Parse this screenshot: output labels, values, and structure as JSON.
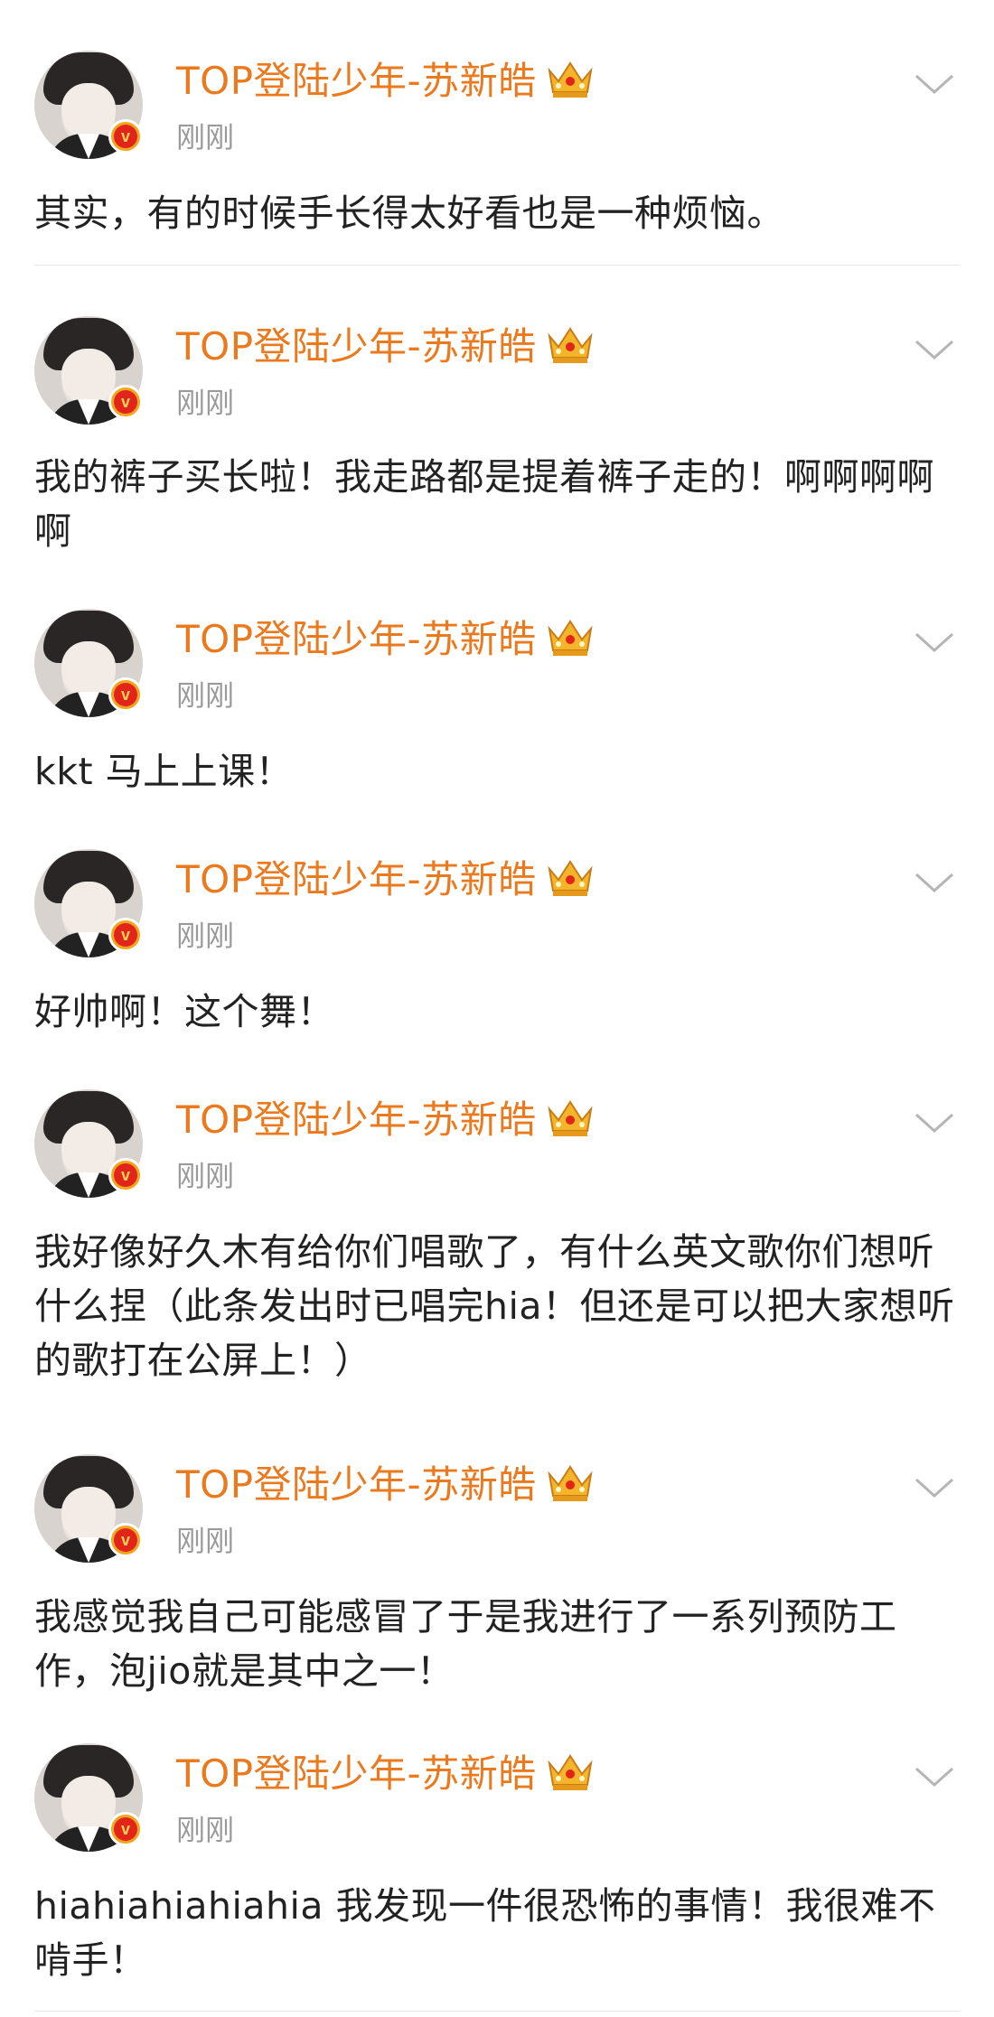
{
  "author_name": "TOP登陆少年-苏新皓",
  "timestamp": "刚刚",
  "accent_color": "#eb7a1f",
  "badge_icon": "verified-v-badge",
  "crown_icon": "crown-vip-icon",
  "posts": [
    {
      "text": "其实，有的时候手长得太好看也是一种烦恼。"
    },
    {
      "text": "我的裤子买长啦！我走路都是提着裤子走的！啊啊啊啊啊"
    },
    {
      "text": "kkt 马上上课！"
    },
    {
      "text": "好帅啊！这个舞！"
    },
    {
      "text": "我好像好久木有给你们唱歌了，有什么英文歌你们想听什么捏（此条发出时已唱完hia！但还是可以把大家想听的歌打在公屏上！）"
    },
    {
      "text": "我感觉我自己可能感冒了于是我进行了一系列预防工作，泡jio就是其中之一！"
    },
    {
      "text": "hiahiahiahiahia 我发现一件很恐怖的事情！我很难不啃手！"
    }
  ]
}
